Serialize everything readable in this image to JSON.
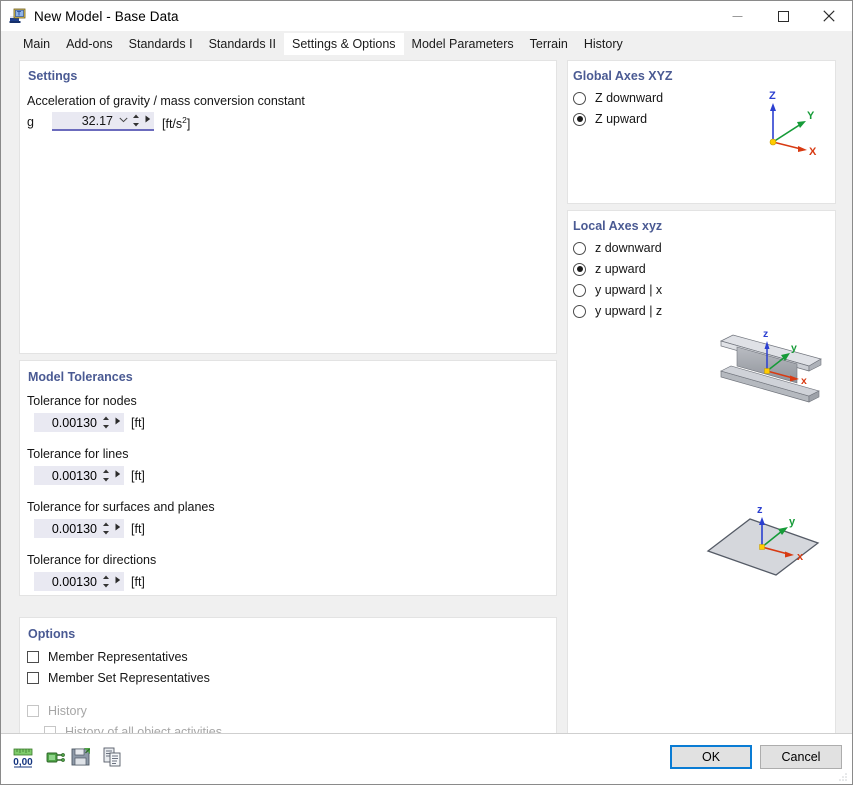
{
  "window": {
    "title": "New Model - Base Data",
    "app_icon": "model-icon",
    "minimize": "—",
    "maximize": "☐",
    "close": "✕"
  },
  "tabs": [
    {
      "label": "Main",
      "active": false
    },
    {
      "label": "Add-ons",
      "active": false
    },
    {
      "label": "Standards I",
      "active": false
    },
    {
      "label": "Standards II",
      "active": false
    },
    {
      "label": "Settings & Options",
      "active": true
    },
    {
      "label": "Model Parameters",
      "active": false
    },
    {
      "label": "Terrain",
      "active": false
    },
    {
      "label": "History",
      "active": false
    }
  ],
  "settings": {
    "title": "Settings",
    "gravity_label": "Acceleration of gravity / mass conversion constant",
    "gravity_symbol": "g",
    "gravity_value": "32.17",
    "gravity_unit": "[ft/s",
    "gravity_unit_sup": "2",
    "gravity_unit_end": "]"
  },
  "tolerances": {
    "title": "Model Tolerances",
    "items": [
      {
        "label": "Tolerance for nodes",
        "value": "0.00130",
        "unit": "[ft]"
      },
      {
        "label": "Tolerance for lines",
        "value": "0.00130",
        "unit": "[ft]"
      },
      {
        "label": "Tolerance for surfaces and planes",
        "value": "0.00130",
        "unit": "[ft]"
      },
      {
        "label": "Tolerance for directions",
        "value": "0.00130",
        "unit": "[ft]"
      }
    ]
  },
  "options": {
    "title": "Options",
    "items": [
      {
        "label": "Member Representatives",
        "checked": false,
        "disabled": false
      },
      {
        "label": "Member Set Representatives",
        "checked": false,
        "disabled": false
      },
      {
        "label": "History",
        "checked": false,
        "disabled": true
      },
      {
        "label": "History of all object activities",
        "checked": false,
        "disabled": true
      }
    ]
  },
  "global_axes": {
    "title": "Global Axes XYZ",
    "options": [
      {
        "label": "Z downward",
        "selected": false
      },
      {
        "label": "Z upward",
        "selected": true
      }
    ],
    "diagram": {
      "z_label": "Z",
      "y_label": "Y",
      "x_label": "X",
      "z_color": "#2b3fd0",
      "y_color": "#169b38",
      "x_color": "#d83a12",
      "origin_color": "#ffcc00"
    }
  },
  "local_axes": {
    "title": "Local Axes xyz",
    "options": [
      {
        "label": "z downward",
        "selected": false
      },
      {
        "label": "z upward",
        "selected": true
      },
      {
        "label": "y upward | x",
        "selected": false
      },
      {
        "label": "y upward | z",
        "selected": false
      }
    ],
    "beam_diagram": {
      "z_label": "z",
      "y_label": "y",
      "x_label": "x",
      "shape": "i-beam"
    },
    "surface_diagram": {
      "z_label": "z",
      "y_label": "y",
      "x_label": "x",
      "shape": "plate"
    }
  },
  "footer": {
    "tools": [
      {
        "name": "decimal-places-icon",
        "label": "0,00"
      },
      {
        "name": "plug-icon",
        "label": ""
      },
      {
        "name": "save-defaults-icon",
        "label": ""
      },
      {
        "name": "copy-settings-icon",
        "label": ""
      }
    ],
    "ok_label": "OK",
    "cancel_label": "Cancel"
  }
}
